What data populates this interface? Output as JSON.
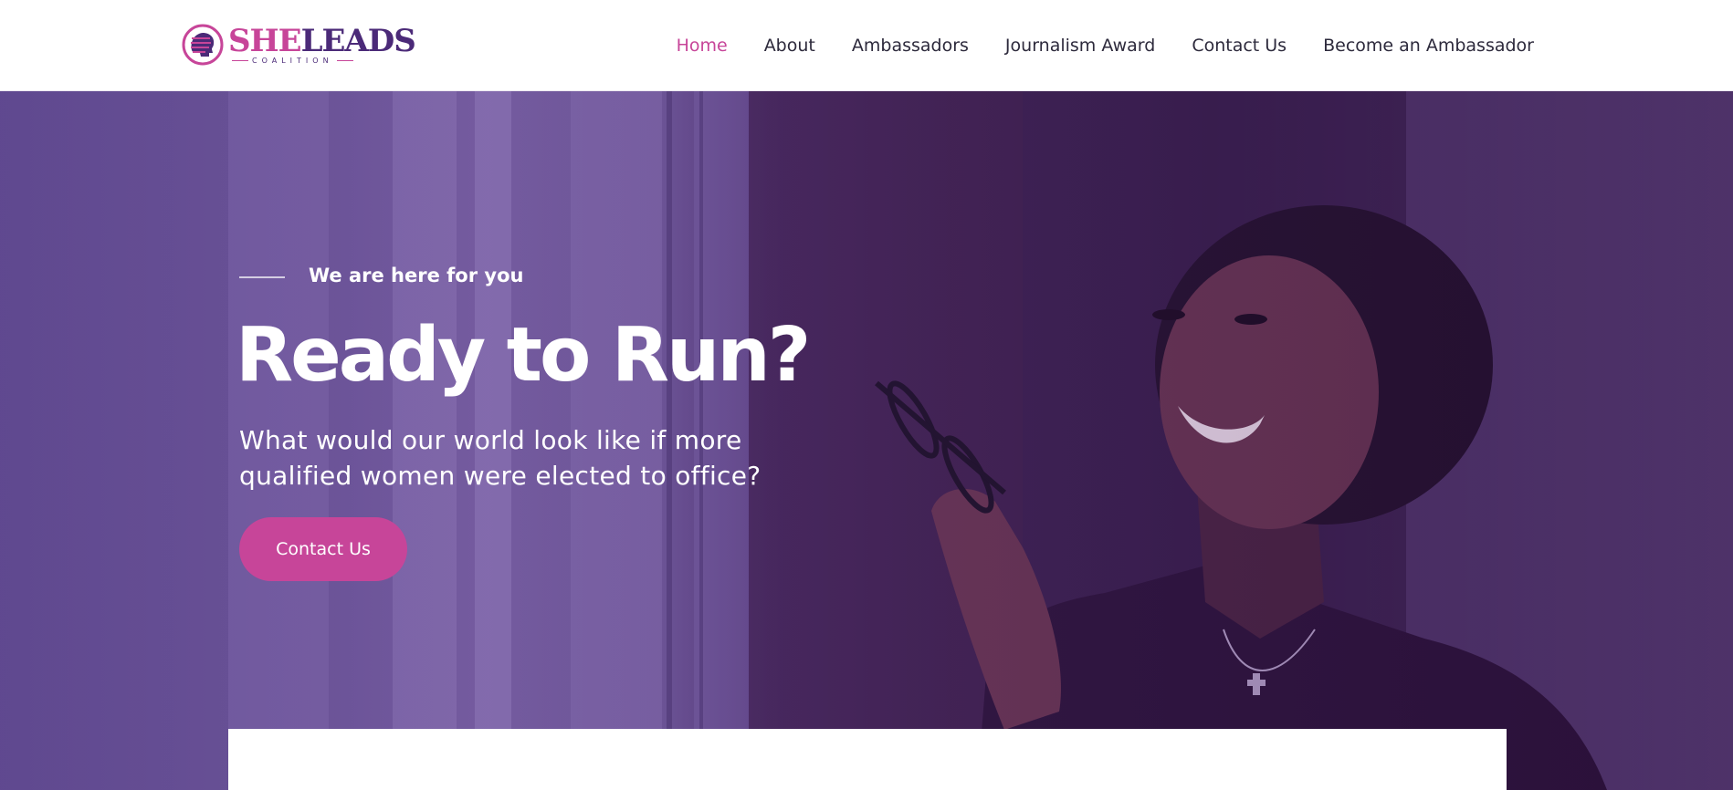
{
  "brand": {
    "she": "SHE",
    "leads": "LEADS",
    "subtitle": "COALITION",
    "logo_icon": "silhouette-head-icon"
  },
  "nav": {
    "items": [
      {
        "label": "Home",
        "active": true
      },
      {
        "label": "About",
        "active": false
      },
      {
        "label": "Ambassadors",
        "active": false
      },
      {
        "label": "Journalism Award",
        "active": false
      },
      {
        "label": "Contact Us",
        "active": false
      },
      {
        "label": "Become an Ambassador",
        "active": false
      }
    ]
  },
  "hero": {
    "eyebrow": "We are here for you",
    "title": "Ready to Run?",
    "subtitle_line1": "What would our world look like if more",
    "subtitle_line2": "qualified women were elected to office?",
    "cta_label": "Contact Us",
    "image_subject": "smiling woman holding glasses"
  },
  "colors": {
    "accent": "#c74599",
    "brand_dark": "#4b2a78",
    "nav_text": "#2d2a3c",
    "hero_tint": "#5d4a8c"
  }
}
